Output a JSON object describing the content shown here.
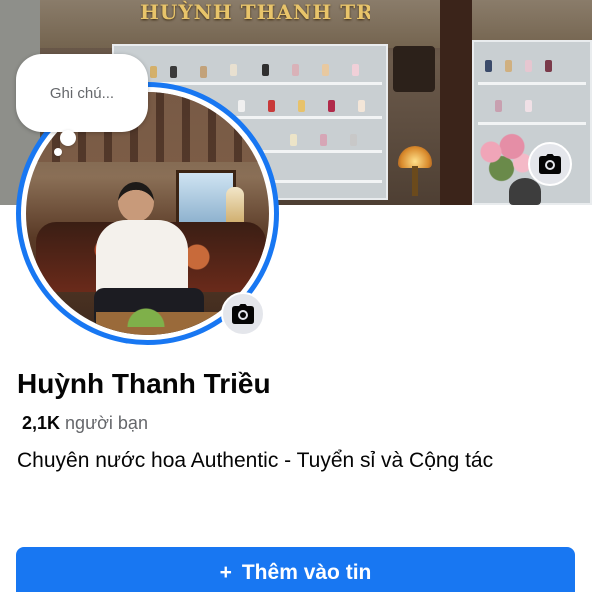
{
  "cover": {
    "shop_sign": "HUỲNH THANH TRIỀU",
    "camera_icon": "camera-icon"
  },
  "note": {
    "placeholder": "Ghi chú..."
  },
  "avatar": {
    "camera_icon": "camera-icon",
    "ring_color": "#1877f2"
  },
  "profile": {
    "name": "Huỳnh Thanh Triều",
    "friends_count": "2,1K",
    "friends_label": "người bạn",
    "bio": "Chuyên nước hoa Authentic - Tuyển sỉ và Cộng tác"
  },
  "actions": {
    "add_story_icon": "+",
    "add_story_label": "Thêm vào tin"
  },
  "colors": {
    "accent": "#1877f2",
    "secondary_text": "#65676b",
    "icon_button_bg": "#e4e6eb"
  }
}
